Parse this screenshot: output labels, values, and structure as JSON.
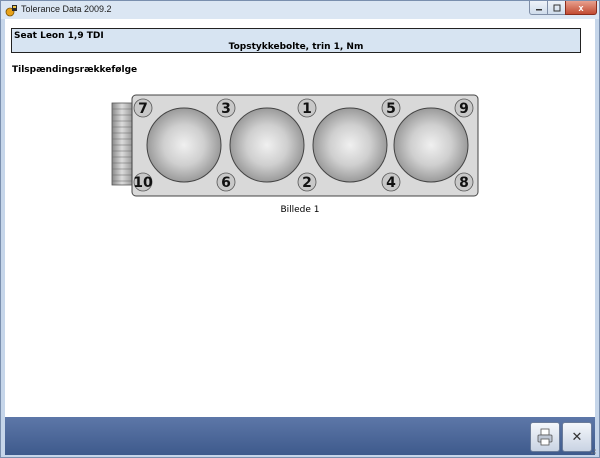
{
  "window": {
    "title": "Tolerance Data 2009.2",
    "controls": [
      "minimize",
      "maximize",
      "close"
    ],
    "close_glyph": "x"
  },
  "header": {
    "car_model": "Seat Leon 1,9 TDI",
    "procedure": "Topstykkebolte, trin 1, Nm"
  },
  "section": {
    "title": "Tilspændingsrækkefølge"
  },
  "diagram": {
    "bolts_top": [
      "7",
      "3",
      "1",
      "5",
      "9"
    ],
    "bolts_bottom": [
      "10",
      "6",
      "2",
      "4",
      "8"
    ],
    "caption": "Billede 1",
    "cylinders": 4
  },
  "toolbar": {
    "print_icon": "print-icon",
    "close_icon": "close-icon",
    "close_glyph": "✕"
  },
  "colors": {
    "header_bg": "#d7e4f2",
    "bottom_bar": "#4a6699",
    "diagram_body": "#d9d9d9"
  }
}
